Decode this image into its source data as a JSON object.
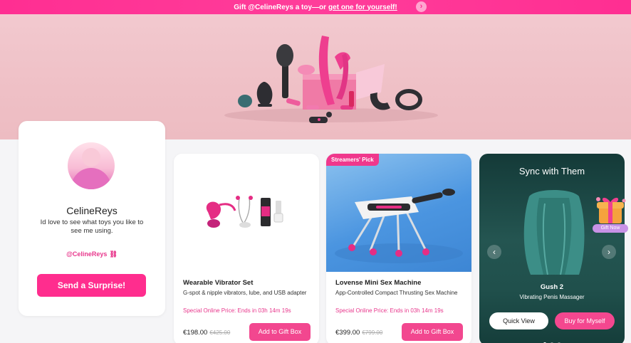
{
  "banner": {
    "text": "Gift @CelineReys a toy—or",
    "link": "get one for yourself!",
    "arrow_icon": "chevron-right-icon"
  },
  "profile": {
    "name": "CelineReys",
    "message": "Id love to see what toys you like to see me using.",
    "handle": "@CelineReys",
    "link_icon": "link-icon",
    "cta": "Send a Surprise!"
  },
  "products": [
    {
      "badge": "",
      "title": "Wearable Vibrator Set",
      "subtitle": "G-spot & nipple vibrators, lube, and USB adapter",
      "offer": "Special Online Price: Ends in  03h 14m 19s",
      "price": "€198.00",
      "old_price": "€425.00",
      "button": "Add to Gift Box"
    },
    {
      "badge": "Streamers' Pick",
      "title": "Lovense Mini Sex Machine",
      "subtitle": "App-Controlled Compact Thrusting Sex Machine",
      "offer": "Special Online Price: Ends in  03h 14m 19s",
      "price": "€399.00",
      "old_price": "€799.00",
      "button": "Add to Gift Box"
    }
  ],
  "sync": {
    "title": "Sync with Them",
    "product_name": "Gush 2",
    "product_sub": "Vibrating Penis Massager",
    "quick_view": "Quick View",
    "buy": "Buy for Myself",
    "prev_icon": "chevron-left-icon",
    "next_icon": "chevron-right-icon",
    "slide_count": 3,
    "active_slide": 1
  },
  "gift_now": {
    "label": "Gift Now",
    "icon": "gift-box-icon"
  },
  "colors": {
    "brand_pink": "#ff2d8e",
    "hero_bg": "#efc0c6",
    "sync_bg": "#20504c"
  }
}
